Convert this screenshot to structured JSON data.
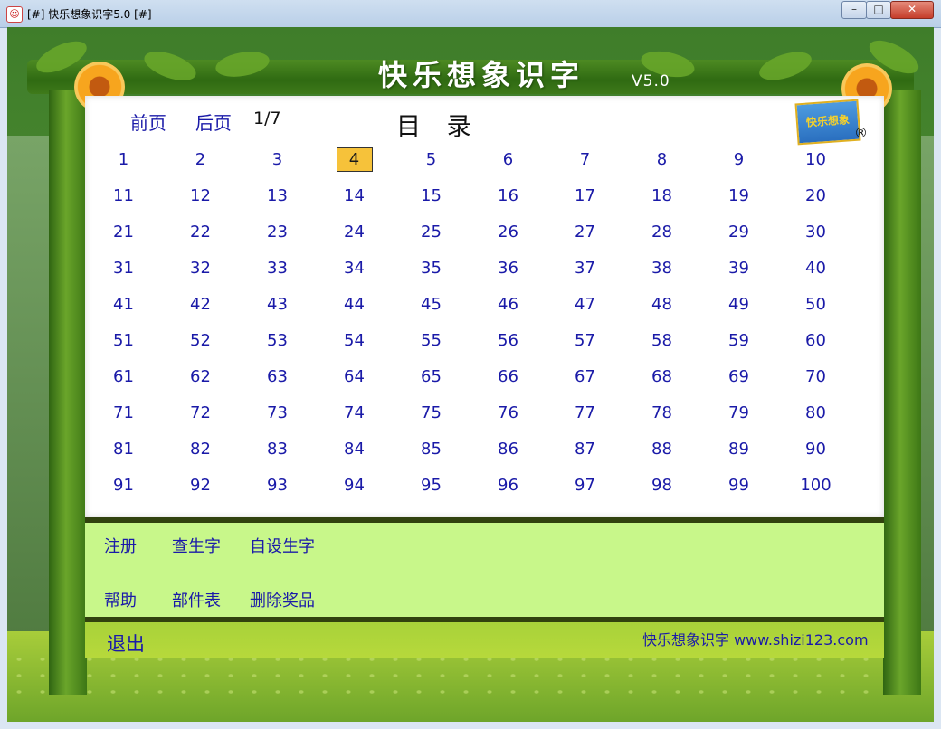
{
  "window": {
    "title": "[#] 快乐想象识字5.0 [#]",
    "icon_label": "☺",
    "controls": {
      "minimize": "–",
      "maximize": "□",
      "close": "✕"
    }
  },
  "header": {
    "app_title": "快乐想象识字",
    "version": "V5.0",
    "logo_text": "快乐想象",
    "registered_mark": "®"
  },
  "nav": {
    "prev_label": "前页",
    "next_label": "后页",
    "page_indicator": "1/7",
    "toc_title": "目 录"
  },
  "lesson_grid": {
    "selected": "4",
    "items": [
      "1",
      "2",
      "3",
      "4",
      "5",
      "6",
      "7",
      "8",
      "9",
      "10",
      "11",
      "12",
      "13",
      "14",
      "15",
      "16",
      "17",
      "18",
      "19",
      "20",
      "21",
      "22",
      "23",
      "24",
      "25",
      "26",
      "27",
      "28",
      "29",
      "30",
      "31",
      "32",
      "33",
      "34",
      "35",
      "36",
      "37",
      "38",
      "39",
      "40",
      "41",
      "42",
      "43",
      "44",
      "45",
      "46",
      "47",
      "48",
      "49",
      "50",
      "51",
      "52",
      "53",
      "54",
      "55",
      "56",
      "57",
      "58",
      "59",
      "60",
      "61",
      "62",
      "63",
      "64",
      "65",
      "66",
      "67",
      "68",
      "69",
      "70",
      "71",
      "72",
      "73",
      "74",
      "75",
      "76",
      "77",
      "78",
      "79",
      "80",
      "81",
      "82",
      "83",
      "84",
      "85",
      "86",
      "87",
      "88",
      "89",
      "90",
      "91",
      "92",
      "93",
      "94",
      "95",
      "96",
      "97",
      "98",
      "99",
      "100"
    ]
  },
  "menu": {
    "register": "注册",
    "check_char": "查生字",
    "custom_char": "自设生字",
    "help": "帮助",
    "parts_table": "部件表",
    "delete_prize": "删除奖品"
  },
  "footer": {
    "exit": "退出",
    "site": "快乐想象识字 www.shizi123.com"
  },
  "colors": {
    "link": "#1a1aa8",
    "selected_bg": "#f6c23a",
    "menu_bg": "#c8f78a",
    "frame_green": "#3f7d2a"
  }
}
